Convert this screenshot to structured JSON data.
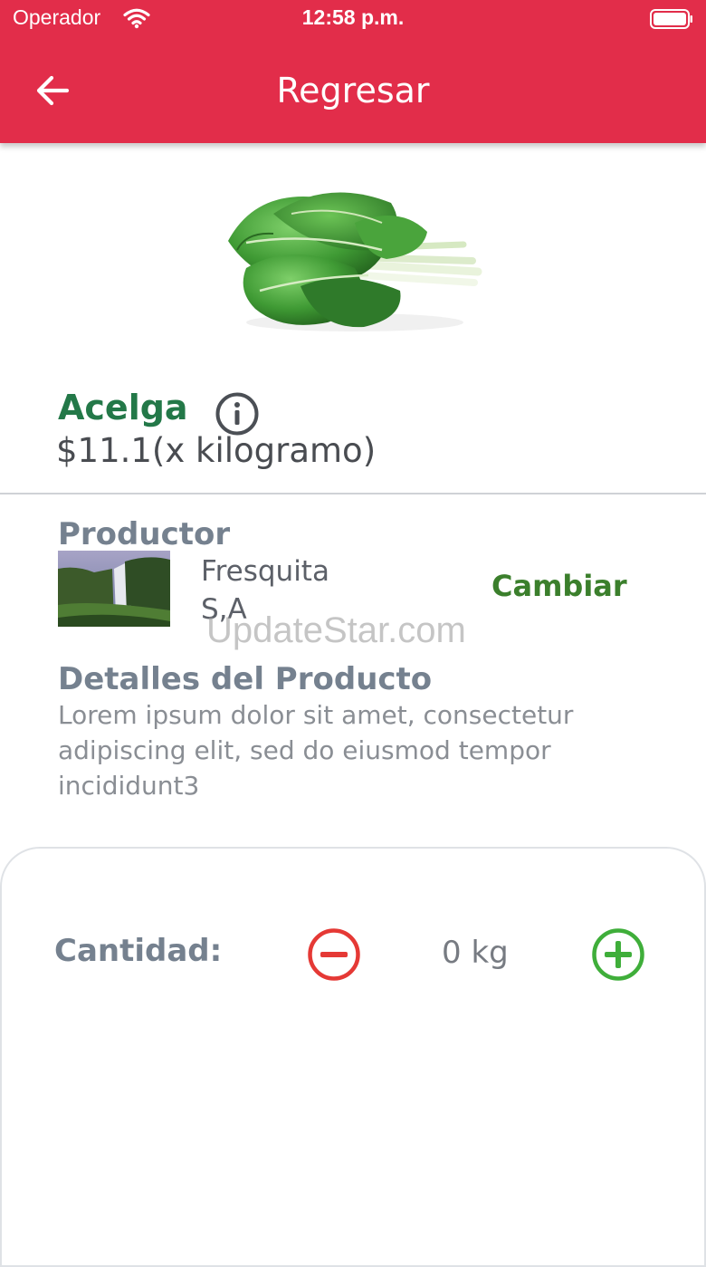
{
  "status_bar": {
    "carrier": "Operador",
    "time": "12:58 p.m.",
    "wifi_icon": "wifi-icon",
    "battery_icon": "battery-icon"
  },
  "app_bar": {
    "title": "Regresar",
    "back_icon": "arrow-left-icon",
    "color": "#e22d4a"
  },
  "product": {
    "name": "Acelga",
    "price": "$11.1(x kilogramo)",
    "info_icon": "info-circle-icon",
    "name_color": "#237848"
  },
  "producer": {
    "title": "Productor",
    "name": "Fresquita S,A",
    "change_label": "Cambiar",
    "change_color": "#3b7f2c"
  },
  "watermark": "UpdateStar.com",
  "details": {
    "title": "Detalles del Producto",
    "text": "Lorem ipsum dolor sit amet, consectetur adipiscing elit, sed do eiusmod tempor incididunt3"
  },
  "quantity": {
    "label": "Cantidad:",
    "value": "0 kg",
    "minus_icon": "minus-circle-icon",
    "plus_icon": "plus-circle-icon",
    "minus_color": "#e53935",
    "plus_color": "#3fae3a"
  }
}
